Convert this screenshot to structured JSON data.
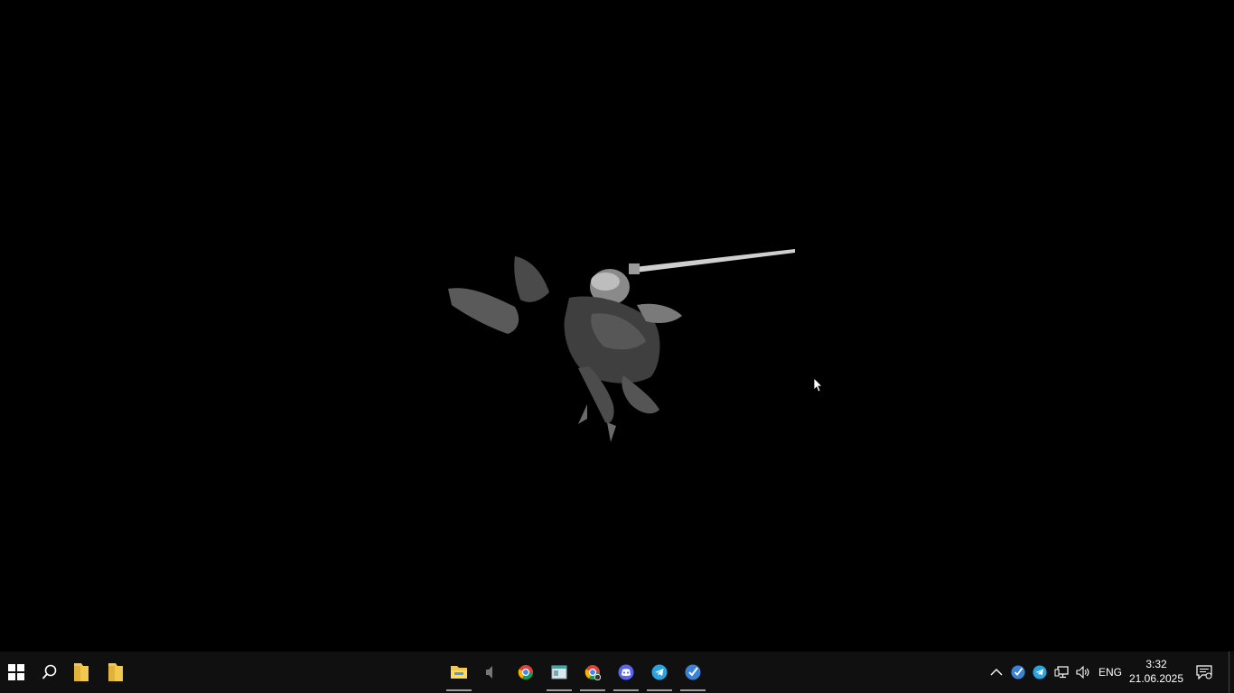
{
  "taskbar": {
    "pinned": [
      {
        "name": "file-explorer-folder-1"
      },
      {
        "name": "file-explorer-folder-2"
      }
    ],
    "apps": [
      {
        "name": "file-explorer",
        "icon": "folder-explorer-icon",
        "active": true
      },
      {
        "name": "audio",
        "icon": "speaker-app-icon",
        "active": false
      },
      {
        "name": "chrome",
        "icon": "chrome-icon",
        "active": true
      },
      {
        "name": "terminal-window",
        "icon": "window-app-icon",
        "active": true
      },
      {
        "name": "chrome-profile-2",
        "icon": "chrome-profile-icon",
        "active": true
      },
      {
        "name": "discord",
        "icon": "discord-icon",
        "active": true
      },
      {
        "name": "telegram",
        "icon": "telegram-icon",
        "active": true
      },
      {
        "name": "vpn-app",
        "icon": "vpn-check-icon",
        "active": true
      }
    ],
    "tray": {
      "language": "ENG",
      "time": "3:32",
      "date": "21.06.2025"
    }
  },
  "colors": {
    "taskbar": "#101010",
    "folder": "#f2c94c",
    "chrome_red": "#db4437",
    "chrome_yellow": "#f4b400",
    "chrome_green": "#0f9d58",
    "chrome_blue": "#4285f4",
    "discord": "#5865f2",
    "telegram": "#2aa3df",
    "vpn": "#3b82d6"
  }
}
